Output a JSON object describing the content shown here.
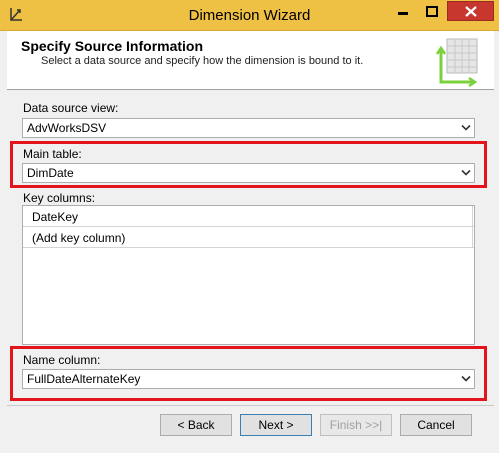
{
  "window": {
    "title": "Dimension Wizard"
  },
  "header": {
    "title": "Specify Source Information",
    "subtitle": "Select a data source and specify how the dimension is bound to it."
  },
  "data_source_view": {
    "label": "Data source view:",
    "value": "AdvWorksDSV"
  },
  "main_table": {
    "label": "Main table:",
    "value": "DimDate"
  },
  "key_columns": {
    "label": "Key columns:",
    "rows": [
      "DateKey",
      "(Add key column)"
    ]
  },
  "name_column": {
    "label": "Name column:",
    "value": "FullDateAlternateKey"
  },
  "buttons": {
    "back": "< Back",
    "next": "Next >",
    "finish": "Finish >>|",
    "cancel": "Cancel"
  },
  "colors": {
    "titlebar": "#eec043",
    "close": "#c7372e",
    "highlight": "#e3141c"
  }
}
